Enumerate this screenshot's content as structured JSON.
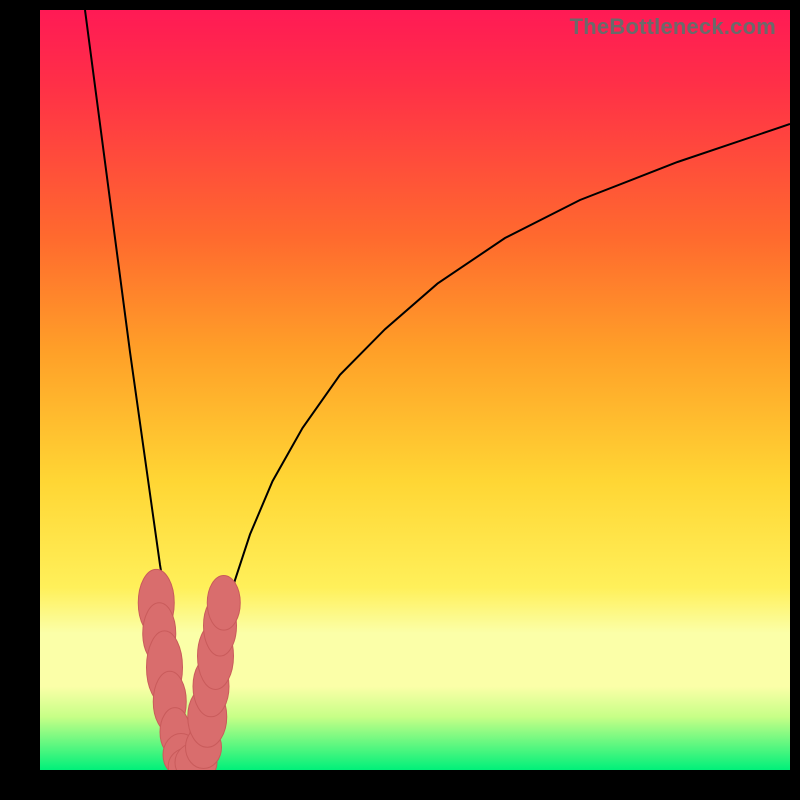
{
  "watermark": "TheBottleneck.com",
  "colors": {
    "top": "#ff1a55",
    "red": "#ff3047",
    "orange_high": "#ff6a2e",
    "orange": "#ffa028",
    "yellow": "#ffd634",
    "yellow_light": "#fff05a",
    "pale": "#fbffa8",
    "green_pale": "#c7ff87",
    "green": "#00f07a",
    "marker": "#d96d6d",
    "curve": "#000000",
    "frame": "#000000"
  },
  "chart_data": {
    "type": "line",
    "title": "",
    "xlabel": "",
    "ylabel": "",
    "x_range": [
      0,
      100
    ],
    "y_range": [
      0,
      100
    ],
    "description": "Bottleneck percentage curve: y is the absolute mismatch between two components as a function of the secondary component's relative performance x. Minimum at x≈20 where bottleneck≈0%; rises steeply toward 100% as x→0 and asymptotically toward ~85% as x→100.",
    "series": [
      {
        "name": "left-branch",
        "x": [
          6,
          8,
          10,
          12,
          14,
          15,
          16,
          17,
          18,
          19,
          19.7
        ],
        "y": [
          100,
          85,
          70,
          55,
          41,
          34,
          27,
          21,
          14,
          7,
          0
        ]
      },
      {
        "name": "right-branch",
        "x": [
          19.7,
          21,
          22,
          24,
          26,
          28,
          31,
          35,
          40,
          46,
          53,
          62,
          72,
          85,
          100
        ],
        "y": [
          0,
          5,
          10,
          18,
          25,
          31,
          38,
          45,
          52,
          58,
          64,
          70,
          75,
          80,
          85
        ]
      }
    ],
    "markers_note": "pink blobs clustered near curve minimum between x≈15 and x≈25, y between 0 and 22",
    "markers": [
      {
        "x": 15.5,
        "y": 22,
        "rx": 1.2,
        "ry": 2.2
      },
      {
        "x": 15.9,
        "y": 18,
        "rx": 1.1,
        "ry": 2.0
      },
      {
        "x": 16.6,
        "y": 13.5,
        "rx": 1.2,
        "ry": 2.4
      },
      {
        "x": 17.3,
        "y": 9.0,
        "rx": 1.1,
        "ry": 2.0
      },
      {
        "x": 18.0,
        "y": 5.0,
        "rx": 1.0,
        "ry": 1.6
      },
      {
        "x": 18.8,
        "y": 2.0,
        "rx": 1.2,
        "ry": 1.4
      },
      {
        "x": 19.7,
        "y": 0.5,
        "rx": 1.3,
        "ry": 1.2
      },
      {
        "x": 20.8,
        "y": 1.0,
        "rx": 1.4,
        "ry": 1.3
      },
      {
        "x": 21.8,
        "y": 3.0,
        "rx": 1.2,
        "ry": 1.4
      },
      {
        "x": 22.3,
        "y": 7.0,
        "rx": 1.3,
        "ry": 2.0
      },
      {
        "x": 22.8,
        "y": 11.0,
        "rx": 1.2,
        "ry": 2.0
      },
      {
        "x": 23.4,
        "y": 15.0,
        "rx": 1.2,
        "ry": 2.2
      },
      {
        "x": 24.0,
        "y": 19.0,
        "rx": 1.1,
        "ry": 2.0
      },
      {
        "x": 24.5,
        "y": 22.0,
        "rx": 1.1,
        "ry": 1.8
      }
    ],
    "gradient_stops": [
      {
        "pct": 0,
        "color": "top"
      },
      {
        "pct": 10,
        "color": "red"
      },
      {
        "pct": 30,
        "color": "orange_high"
      },
      {
        "pct": 45,
        "color": "orange"
      },
      {
        "pct": 62,
        "color": "yellow"
      },
      {
        "pct": 76,
        "color": "yellow_light"
      },
      {
        "pct": 82,
        "color": "pale"
      },
      {
        "pct": 89,
        "color": "pale"
      },
      {
        "pct": 93,
        "color": "green_pale"
      },
      {
        "pct": 100,
        "color": "green"
      }
    ]
  }
}
